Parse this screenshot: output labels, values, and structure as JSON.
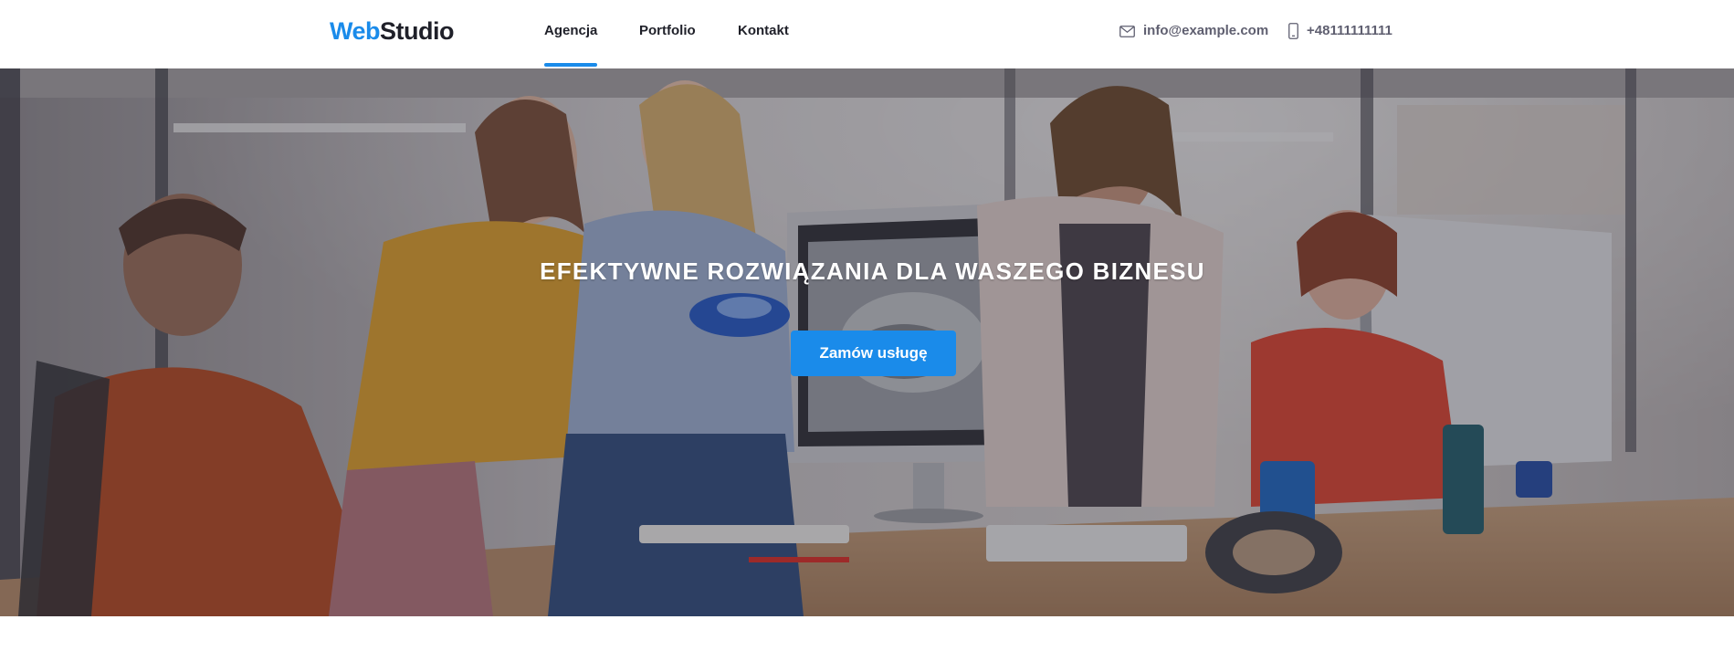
{
  "header": {
    "logo": {
      "part1": "Web",
      "part2": "Studio"
    },
    "nav": [
      {
        "label": "Agencja",
        "active": true
      },
      {
        "label": "Portfolio",
        "active": false
      },
      {
        "label": "Kontakt",
        "active": false
      }
    ],
    "contacts": {
      "email": {
        "icon": "envelope-icon",
        "text": "info@example.com"
      },
      "phone": {
        "icon": "smartphone-icon",
        "text": "+48111111111"
      }
    }
  },
  "hero": {
    "title": "EFEKTYWNE ROZWIĄZANIA DLA WASZEGO BIZNESU",
    "button_label": "Zamów usługę"
  },
  "colors": {
    "accent": "#1a8bea",
    "text_dark": "#1f2029",
    "text_muted": "#5f5f70"
  }
}
